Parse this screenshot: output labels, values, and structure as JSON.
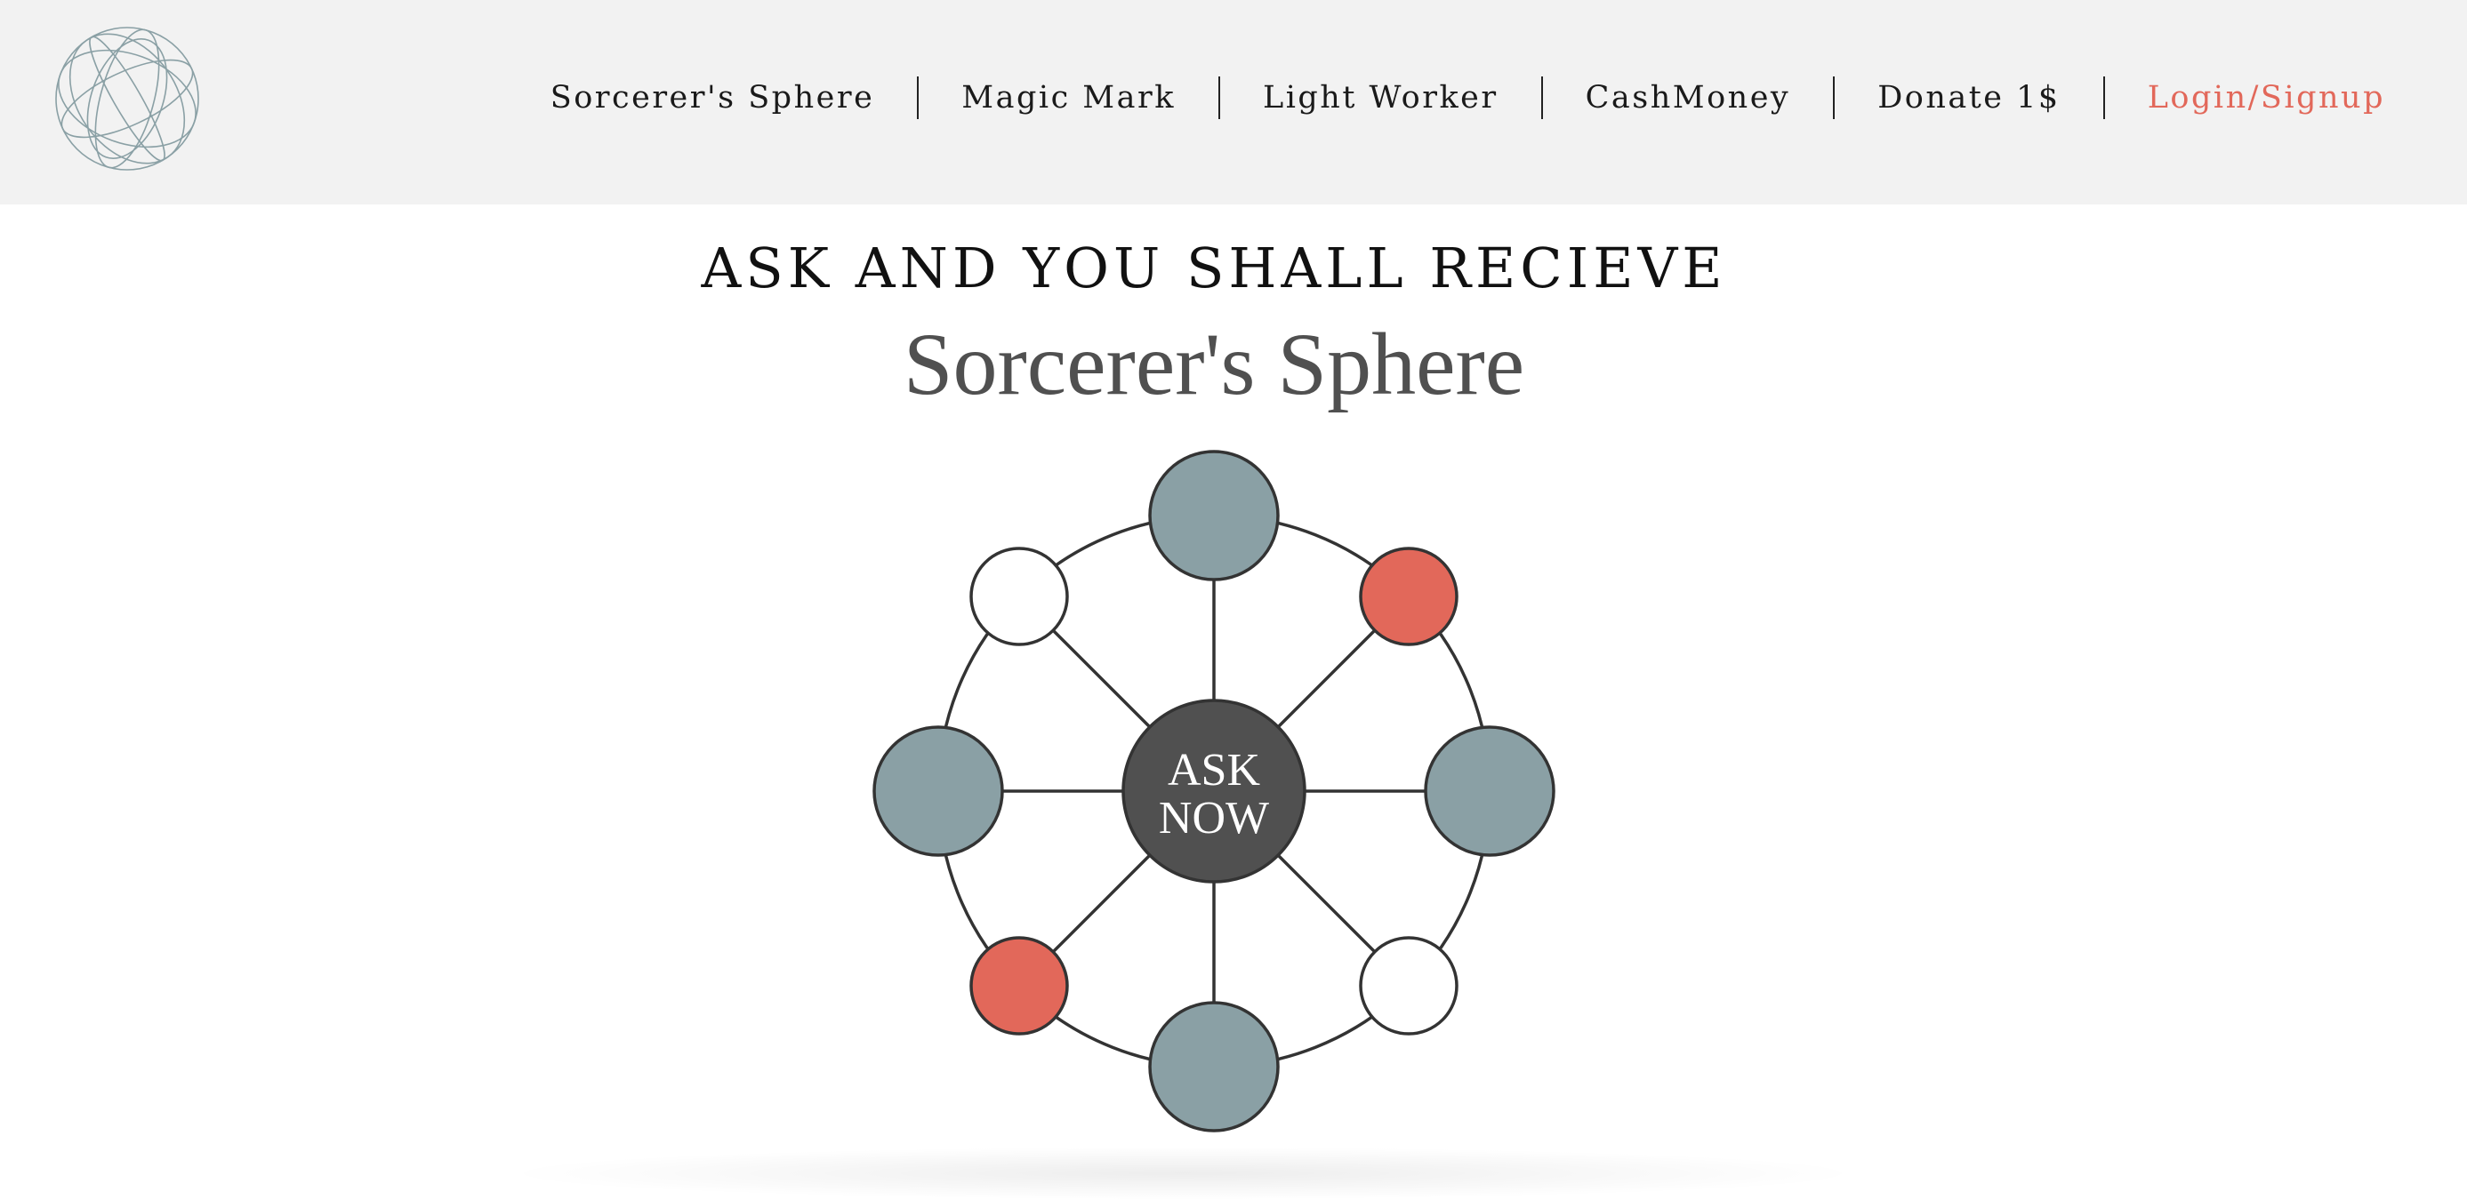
{
  "header": {
    "logo_icon": "wireframe-sphere-icon",
    "nav": [
      {
        "label": "Sorcerer's Sphere"
      },
      {
        "label": "Magic Mark"
      },
      {
        "label": "Light Worker"
      },
      {
        "label": "CashMoney"
      },
      {
        "label": "Donate 1$"
      },
      {
        "label": "Login/Signup"
      }
    ],
    "accent_color": "#e2685a"
  },
  "hero": {
    "tagline": "ASK AND YOU SHALL RECIEVE",
    "title": "Sorcerer's Sphere"
  },
  "sphere": {
    "center_label_line1": "ASK",
    "center_label_line2": "NOW",
    "center_color": "#505050",
    "nodes": [
      {
        "position": "top",
        "kind": "large",
        "color": "#8aa0a5"
      },
      {
        "position": "top-right",
        "kind": "small",
        "color": "#e2685a"
      },
      {
        "position": "right",
        "kind": "large",
        "color": "#8aa0a5"
      },
      {
        "position": "bottom-right",
        "kind": "small",
        "color": "#ffffff"
      },
      {
        "position": "bottom",
        "kind": "large",
        "color": "#8aa0a5"
      },
      {
        "position": "bottom-left",
        "kind": "small",
        "color": "#e2685a"
      },
      {
        "position": "left",
        "kind": "large",
        "color": "#8aa0a5"
      },
      {
        "position": "top-left",
        "kind": "small",
        "color": "#ffffff"
      }
    ]
  }
}
